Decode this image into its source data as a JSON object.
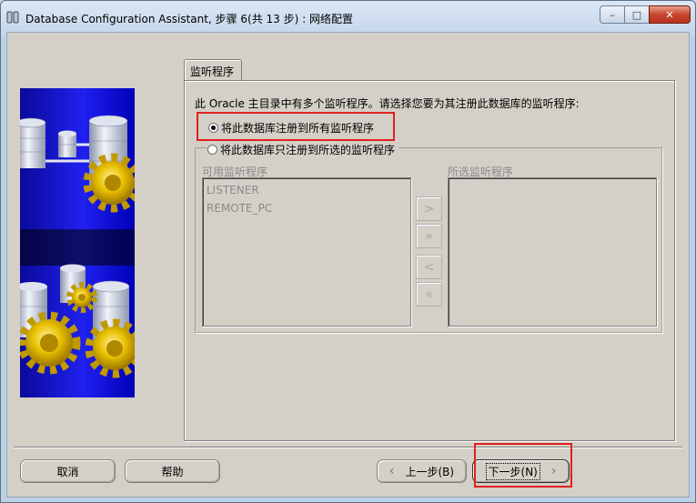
{
  "window": {
    "title": "Database Configuration Assistant, 步骤 6(共 13 步) : 网络配置",
    "minimize": "–",
    "maximize": "□",
    "close": "✕"
  },
  "tab": {
    "label": "监听程序"
  },
  "prompt": "此 Oracle 主目录中有多个监听程序。请选择您要为其注册此数据库的监听程序:",
  "options": {
    "all": {
      "label": "将此数据库注册到所有监听程序",
      "selected": true
    },
    "selected": {
      "label": "将此数据库只注册到所选的监听程序",
      "selected": false
    }
  },
  "lists": {
    "available_label": "可用监听程序",
    "available_items": [
      "LISTENER",
      "REMOTE_PC"
    ],
    "selected_label": "所选监听程序",
    "selected_items": []
  },
  "move_buttons": {
    "add": ">",
    "add_all": "»",
    "remove": "<",
    "remove_all": "«"
  },
  "buttons": {
    "cancel": "取消",
    "help": "帮助",
    "back": "上一步(B)",
    "next": "下一步(N)"
  },
  "colors": {
    "highlight": "#e02020",
    "art_blue": "#1a1ae8",
    "gear_gold": "#e6b800"
  }
}
